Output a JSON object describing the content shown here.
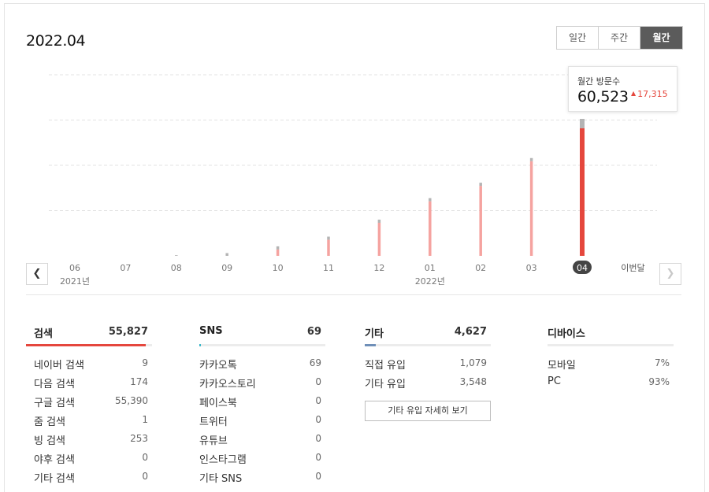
{
  "header": {
    "period": "2022.04",
    "tabs": [
      {
        "label": "일간",
        "active": false
      },
      {
        "label": "주간",
        "active": false
      },
      {
        "label": "월간",
        "active": true
      }
    ]
  },
  "tooltip": {
    "label": "월간 방문수",
    "value": "60,523",
    "delta": "17,315",
    "delta_direction": "up",
    "delta_color": "#e5473d"
  },
  "chart_data": {
    "type": "bar",
    "categories": [
      "06",
      "07",
      "08",
      "09",
      "10",
      "11",
      "12",
      "01",
      "02",
      "03",
      "04"
    ],
    "year_labels": [
      {
        "at": "06",
        "label": "2021년"
      },
      {
        "at": "01",
        "label": "2022년"
      }
    ],
    "current_label": "이번달",
    "selected": "04",
    "values": [
      0,
      0,
      300,
      1200,
      4200,
      8500,
      16000,
      25500,
      32300,
      43208,
      60523
    ],
    "ylim": [
      0,
      80000
    ],
    "grid": true,
    "colors": {
      "bar": "#f5a3a0",
      "selected_bar": "#e5473d",
      "bar_cap": "#b4b4b4"
    }
  },
  "nav": {
    "prev_icon": "chevron-left-icon",
    "next_icon": "chevron-right-icon"
  },
  "sections": [
    {
      "title": "검색",
      "total": "55,827",
      "accent": "#e5473d",
      "fill": 0.95,
      "rows": [
        {
          "label": "네이버 검색",
          "value": "9"
        },
        {
          "label": "다음 검색",
          "value": "174"
        },
        {
          "label": "구글 검색",
          "value": "55,390"
        },
        {
          "label": "줌 검색",
          "value": "1"
        },
        {
          "label": "빙 검색",
          "value": "253"
        },
        {
          "label": "야후 검색",
          "value": "0"
        },
        {
          "label": "기타 검색",
          "value": "0"
        }
      ]
    },
    {
      "title": "SNS",
      "total": "69",
      "accent": "#3ab7c9",
      "fill": 0.01,
      "rows": [
        {
          "label": "카카오톡",
          "value": "69"
        },
        {
          "label": "카카오스토리",
          "value": "0"
        },
        {
          "label": "페이스북",
          "value": "0"
        },
        {
          "label": "트위터",
          "value": "0"
        },
        {
          "label": "유튜브",
          "value": "0"
        },
        {
          "label": "인스타그램",
          "value": "0"
        },
        {
          "label": "기타 SNS",
          "value": "0"
        }
      ]
    },
    {
      "title": "기타",
      "total": "4,627",
      "accent": "#6f8fb8",
      "fill": 0.09,
      "rows": [
        {
          "label": "직접 유입",
          "value": "1,079"
        },
        {
          "label": "기타 유입",
          "value": "3,548"
        }
      ],
      "button_label": "기타 유입 자세히 보기"
    },
    {
      "title": "디바이스",
      "total": "",
      "accent": "#e5473d",
      "fill": 0,
      "rows": [
        {
          "label": "모바일",
          "value": "7%"
        },
        {
          "label": "PC",
          "value": "93%"
        }
      ]
    }
  ]
}
